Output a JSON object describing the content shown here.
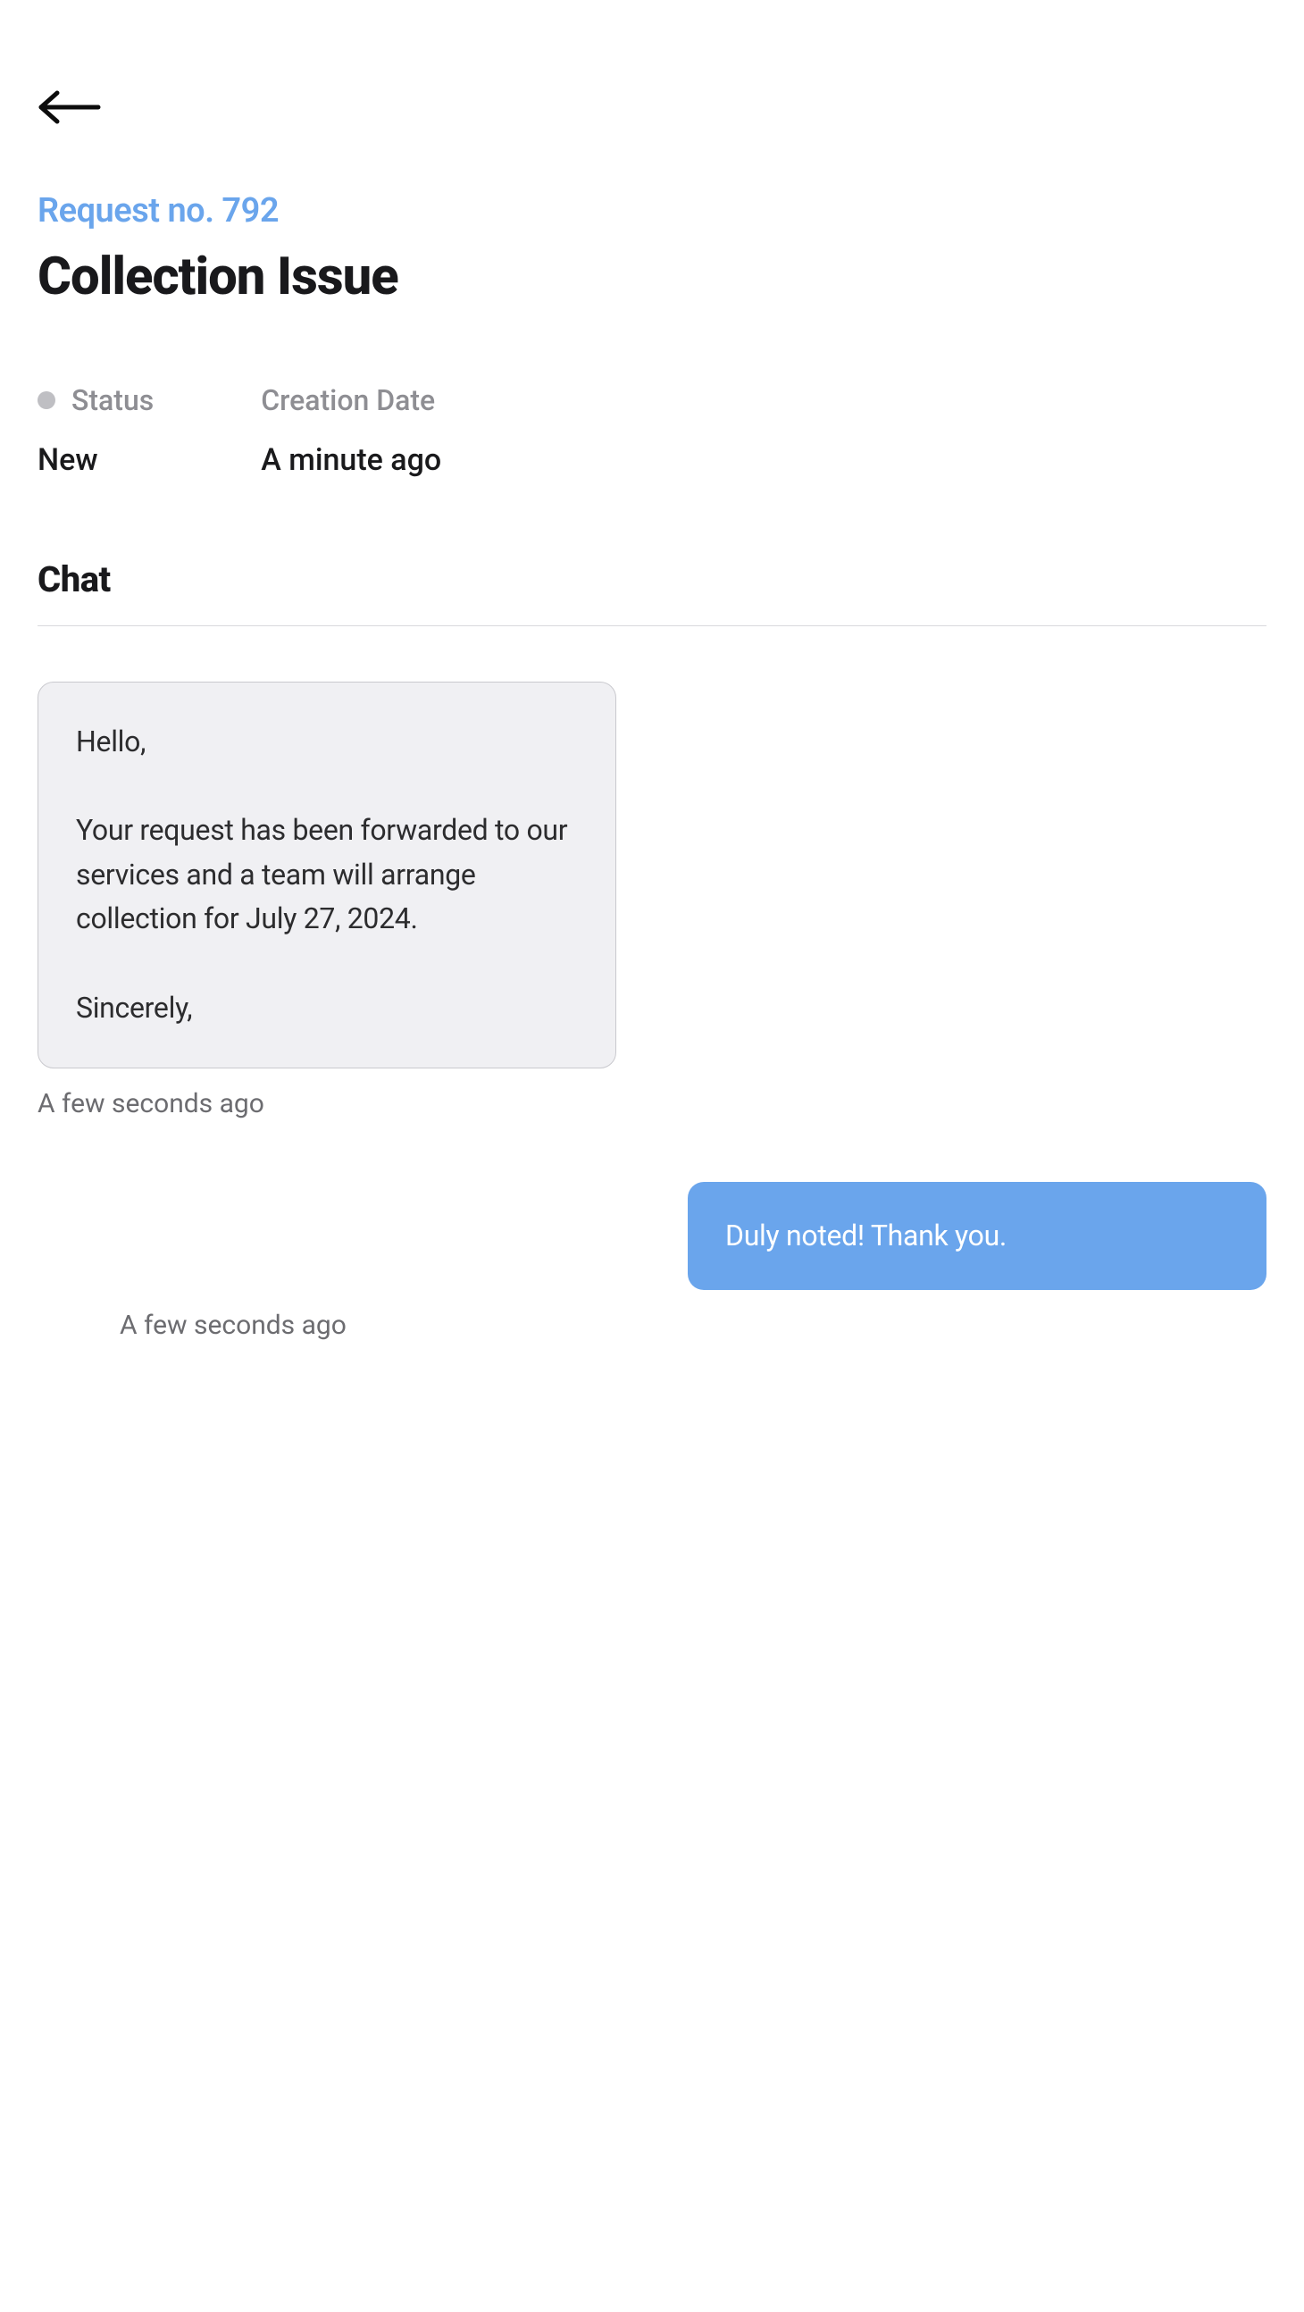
{
  "request": {
    "number_label": "Request no. 792",
    "title": "Collection Issue"
  },
  "meta": {
    "status_label": "Status",
    "status_value": "New",
    "created_label": "Creation Date",
    "created_value": "A minute ago"
  },
  "chat": {
    "header": "Chat",
    "incoming": {
      "body": "Hello,\n\nYour request has been forwarded to our services and a team will arrange collection for July 27, 2024.\n\nSincerely,",
      "timestamp": "A few seconds ago"
    },
    "outgoing": {
      "body": "Duly noted!  Thank you.",
      "timestamp": "A few seconds ago"
    }
  }
}
